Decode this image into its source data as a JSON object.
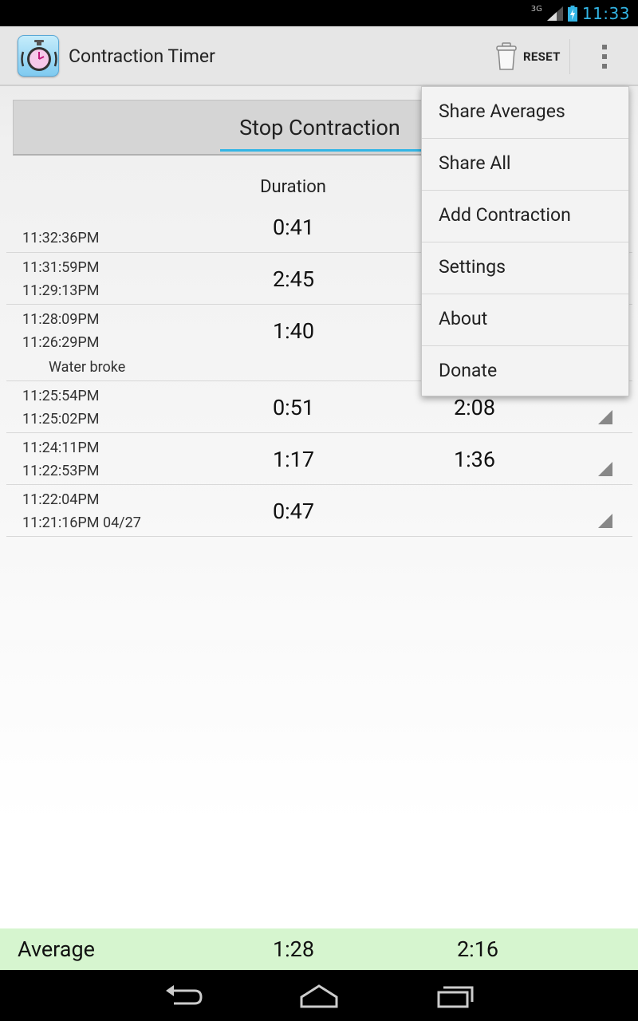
{
  "status_bar": {
    "network": "3G",
    "time": "11:33"
  },
  "action_bar": {
    "title": "Contraction Timer",
    "reset_label": "RESET"
  },
  "stop_button": {
    "label": "Stop Contraction"
  },
  "columns": {
    "duration": "Duration"
  },
  "contractions": [
    {
      "start": "",
      "end": "11:32:36PM",
      "duration": "0:41",
      "frequency": "",
      "note": ""
    },
    {
      "start": "11:31:59PM",
      "end": "11:29:13PM",
      "duration": "2:45",
      "frequency": "",
      "note": ""
    },
    {
      "start": "11:28:09PM",
      "end": "11:26:29PM",
      "duration": "1:40",
      "frequency": "",
      "note": "Water broke"
    },
    {
      "start": "11:25:54PM",
      "end": "11:25:02PM",
      "duration": "0:51",
      "frequency": "2:08",
      "note": ""
    },
    {
      "start": "11:24:11PM",
      "end": "11:22:53PM",
      "duration": "1:17",
      "frequency": "1:36",
      "note": ""
    },
    {
      "start": "11:22:04PM",
      "end": "11:21:16PM 04/27",
      "duration": "0:47",
      "frequency": "",
      "note": ""
    }
  ],
  "average": {
    "label": "Average",
    "duration": "1:28",
    "frequency": "2:16"
  },
  "menu": {
    "items": [
      {
        "label": "Share Averages"
      },
      {
        "label": "Share All"
      },
      {
        "label": "Add Contraction"
      },
      {
        "label": "Settings"
      },
      {
        "label": "About"
      },
      {
        "label": "Donate"
      }
    ]
  },
  "nav": {
    "icons": [
      "back-icon",
      "home-icon",
      "recent-apps-icon"
    ]
  },
  "colors": {
    "accent": "#33b5e5",
    "footer_bg": "#d6f5cf",
    "status_time": "#33b5e5"
  }
}
